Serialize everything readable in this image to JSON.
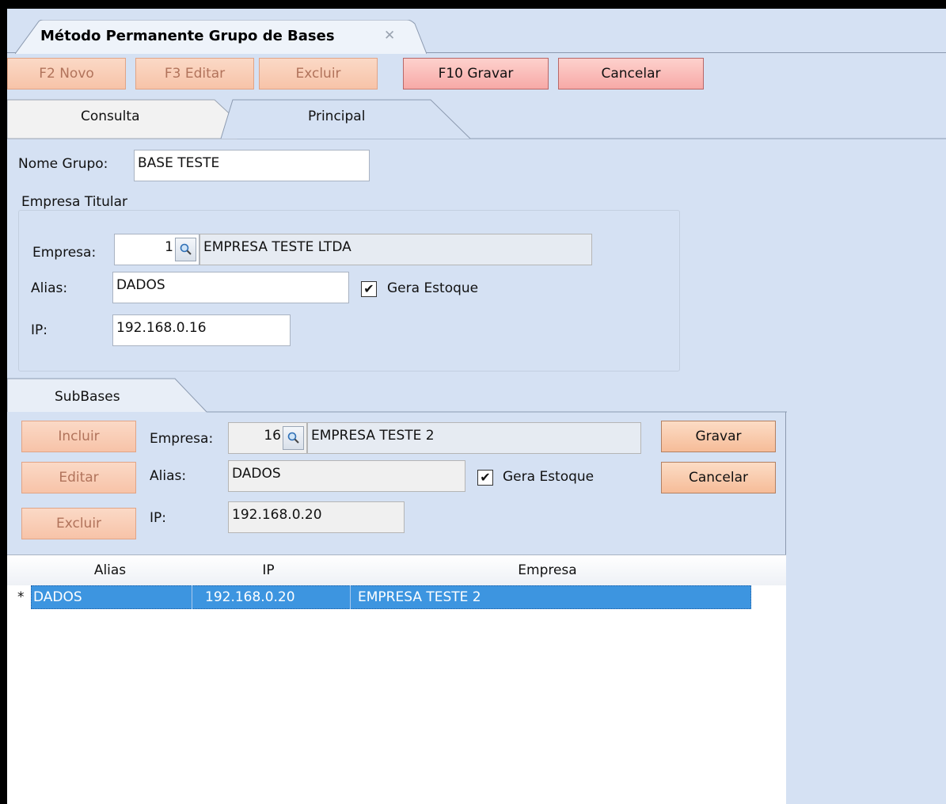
{
  "window": {
    "title": "Método Permanente Grupo de Bases",
    "close_glyph": "✕"
  },
  "toolbar": {
    "novo": "F2 Novo",
    "editar": "F3 Editar",
    "excluir": "Excluir",
    "gravar": "F10 Gravar",
    "cancelar": "Cancelar"
  },
  "tabs": {
    "consulta": "Consulta",
    "principal": "Principal"
  },
  "form": {
    "nome_grupo_label": "Nome Grupo:",
    "nome_grupo_value": "BASE TESTE"
  },
  "empresa_titular": {
    "section_label": "Empresa Titular",
    "empresa_label": "Empresa:",
    "empresa_code": "1",
    "empresa_name": "EMPRESA TESTE LTDA",
    "alias_label": "Alias:",
    "alias_value": "DADOS",
    "gera_estoque_label": "Gera Estoque",
    "gera_estoque_checked": true,
    "ip_label": "IP:",
    "ip_value": "192.168.0.16"
  },
  "subbases": {
    "tab_label": "SubBases",
    "incluir": "Incluir",
    "editar": "Editar",
    "excluir": "Excluir",
    "empresa_label": "Empresa:",
    "empresa_code": "16",
    "empresa_name": "EMPRESA TESTE 2",
    "alias_label": "Alias:",
    "alias_value": "DADOS",
    "gera_estoque_label": "Gera Estoque",
    "gera_estoque_checked": true,
    "ip_label": "IP:",
    "ip_value": "192.168.0.20",
    "gravar": "Gravar",
    "cancelar": "Cancelar"
  },
  "grid": {
    "columns": [
      "Alias",
      "IP",
      "Empresa"
    ],
    "rows": [
      {
        "marker": "*",
        "alias": "DADOS",
        "ip": "192.168.0.20",
        "empresa": "EMPRESA TESTE 2"
      }
    ]
  },
  "icons": {
    "lookup": "magnifier-icon",
    "close": "close-icon",
    "check": "checkmark-icon"
  },
  "colors": {
    "background": "#d5e1f3",
    "selection": "#3d95e0",
    "button_disabled": "#f7c3a8",
    "button_primary": "#f7a9a7"
  }
}
